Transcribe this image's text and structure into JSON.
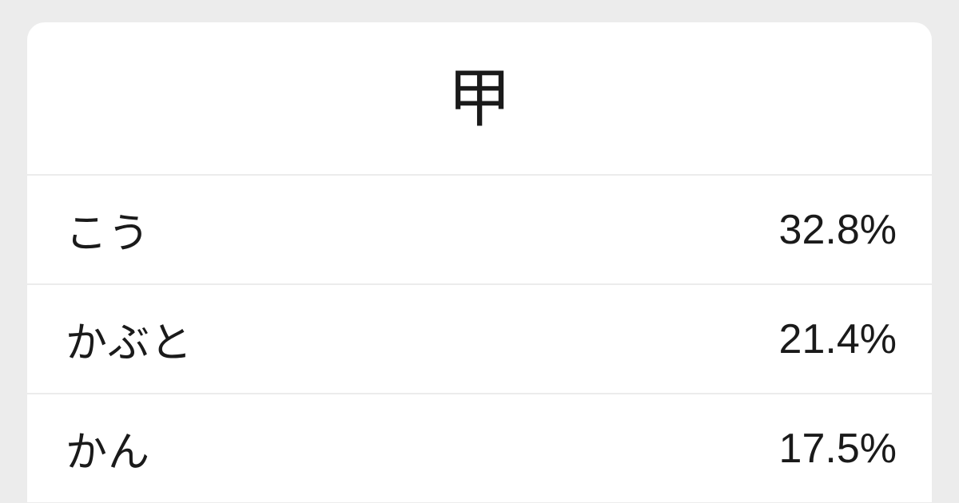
{
  "header": {
    "kanji": "甲"
  },
  "rows": [
    {
      "reading": "こう",
      "percent": "32.8%"
    },
    {
      "reading": "かぶと",
      "percent": "21.4%"
    },
    {
      "reading": "かん",
      "percent": "17.5%"
    }
  ]
}
